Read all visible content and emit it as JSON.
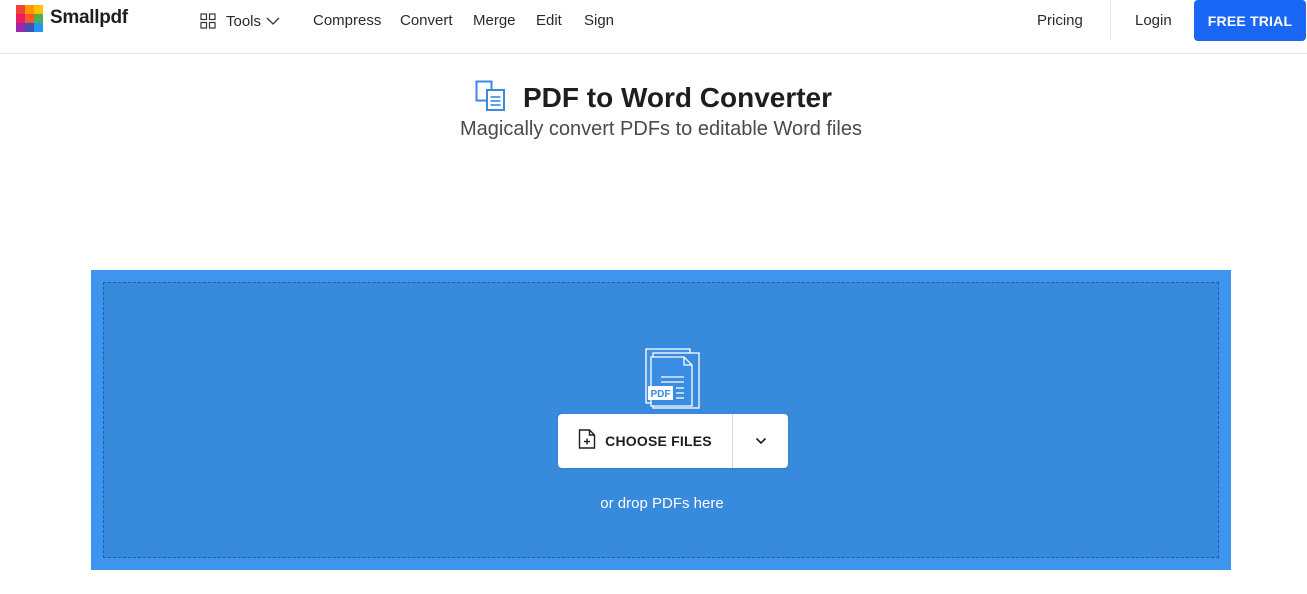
{
  "brand": {
    "name": "Smallpdf",
    "logo_colors": [
      "#f44336",
      "#ff9800",
      "#ffc107",
      "#e91e63",
      "#ff5722",
      "#4caf50",
      "#9c27b0",
      "#3f51b5",
      "#2196f3"
    ]
  },
  "nav": {
    "tools_label": "Tools",
    "links": [
      "Compress",
      "Convert",
      "Merge",
      "Edit",
      "Sign"
    ],
    "pricing": "Pricing",
    "login": "Login",
    "free_trial": "FREE TRIAL"
  },
  "hero": {
    "title": "PDF to Word Converter",
    "subtitle": "Magically convert PDFs to editable Word files",
    "icon": "word-converter-icon"
  },
  "dropzone": {
    "illustration_badge": "PDF",
    "choose_files": "CHOOSE FILES",
    "drop_hint": "or drop PDFs here"
  },
  "colors": {
    "accent": "#1a66f5",
    "dropzone_outer": "#3e95ee",
    "dropzone_inner": "#388add",
    "hero_icon": "#3a8be0"
  }
}
